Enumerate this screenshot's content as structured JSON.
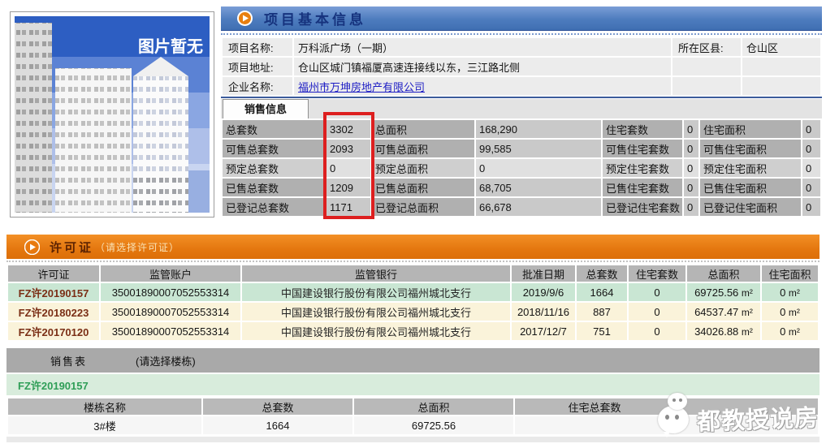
{
  "photo": {
    "no_image_label": "图片暂无"
  },
  "basic_info": {
    "title": "项目基本信息",
    "name_label": "项目名称:",
    "name_value": "万科派广场（一期）",
    "district_label": "所在区县:",
    "district_value": "仓山区",
    "address_label": "项目地址:",
    "address_value": "仓山区城门镇福厦高速连接线以东，三江路北侧",
    "company_label": "企业名称:",
    "company_value": "福州市万坤房地产有限公司"
  },
  "sales_info": {
    "tab_label": "销售信息",
    "rows": [
      [
        "总套数",
        "3302",
        "总面积",
        "168,290",
        "住宅套数",
        "0",
        "住宅面积",
        "0"
      ],
      [
        "可售总套数",
        "2093",
        "可售总面积",
        "99,585",
        "可售住宅套数",
        "0",
        "可售住宅面积",
        "0"
      ],
      [
        "预定总套数",
        "0",
        "预定总面积",
        "0",
        "预定住宅套数",
        "0",
        "预定住宅面积",
        "0"
      ],
      [
        "已售总套数",
        "1209",
        "已售总面积",
        "68,705",
        "已售住宅套数",
        "0",
        "已售住宅面积",
        "0"
      ],
      [
        "已登记总套数",
        "1171",
        "已登记总面积",
        "66,678",
        "已登记住宅套数",
        "0",
        "已登记住宅面积",
        "0"
      ]
    ]
  },
  "license": {
    "title": "许可证",
    "subtitle": "（请选择许可证）",
    "columns": [
      "许可证",
      "监管账户",
      "监管银行",
      "批准日期",
      "总套数",
      "住宅套数",
      "总面积",
      "住宅面积"
    ],
    "area_unit": "m²",
    "rows": [
      {
        "code": "FZ许20190157",
        "account": "35001890007052553314",
        "bank": "中国建设银行股份有限公司福州城北支行",
        "date": "2019/9/6",
        "total_units": "1664",
        "residential_units": "0",
        "total_area": "69725.56",
        "residential_area": "0"
      },
      {
        "code": "FZ许20180223",
        "account": "35001890007052553314",
        "bank": "中国建设银行股份有限公司福州城北支行",
        "date": "2018/11/16",
        "total_units": "887",
        "residential_units": "0",
        "total_area": "64537.47",
        "residential_area": "0"
      },
      {
        "code": "FZ许20170120",
        "account": "35001890007052553314",
        "bank": "中国建设银行股份有限公司福州城北支行",
        "date": "2017/12/7",
        "total_units": "751",
        "residential_units": "0",
        "total_area": "34026.88",
        "residential_area": "0"
      }
    ]
  },
  "sales_table": {
    "title": "销售表",
    "subtitle": "(请选择楼栋)",
    "selected_license": "FZ许20190157",
    "columns": [
      "楼栋名称",
      "总套数",
      "总面积",
      "住宅总套数",
      ""
    ],
    "rows": [
      {
        "building": "3#楼",
        "total_units": "1664",
        "total_area": "69725.56",
        "residential_units": "",
        "col5": ""
      }
    ]
  },
  "watermark": {
    "text": "都教授说房"
  },
  "colors": {
    "header_blue": "#4a7cc0",
    "header_orange": "#e8790f",
    "title_navy": "#16337e",
    "license_title_maroon": "#5c2202",
    "highlight_red": "#dd1f1f",
    "license_row_green": "#c9e6d3",
    "license_row_cream": "#faf3da",
    "selected_license_green": "#2f9e57",
    "link_blue": "#1c1cc4"
  }
}
